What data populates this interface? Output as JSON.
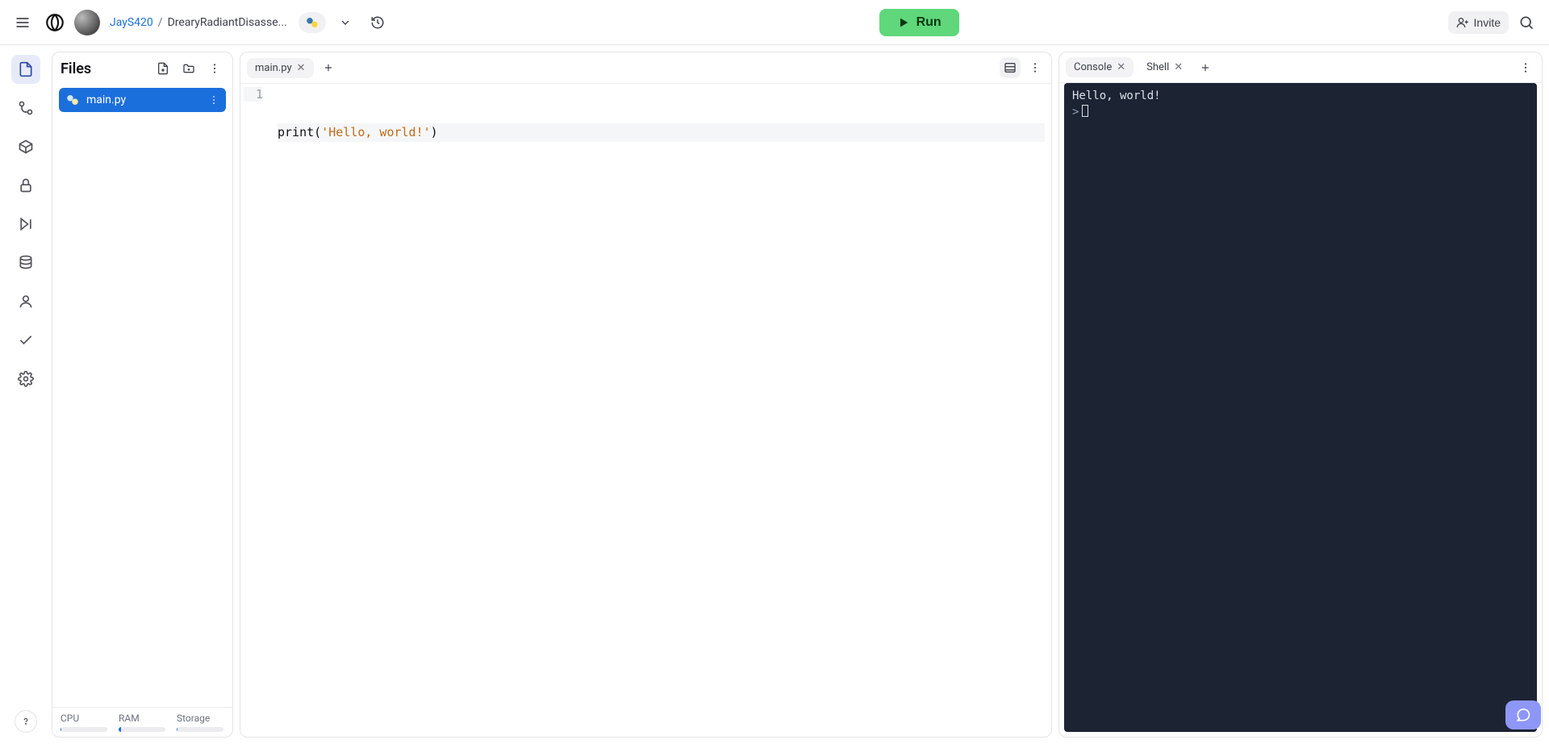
{
  "header": {
    "user": "JayS420",
    "sep": "/",
    "project": "DrearyRadiantDisasse...",
    "run_label": "Run",
    "invite_label": "Invite"
  },
  "rail": {
    "items": [
      {
        "name": "files-icon",
        "active": true
      },
      {
        "name": "version-control-icon",
        "active": false
      },
      {
        "name": "packages-icon",
        "active": false
      },
      {
        "name": "secrets-icon",
        "active": false
      },
      {
        "name": "debugger-icon",
        "active": false
      },
      {
        "name": "database-icon",
        "active": false
      },
      {
        "name": "account-icon",
        "active": false
      },
      {
        "name": "checkmark-icon",
        "active": false
      },
      {
        "name": "settings-icon",
        "active": false
      }
    ]
  },
  "files": {
    "title": "Files",
    "items": [
      {
        "name": "main.py",
        "active": true
      }
    ],
    "meters": [
      {
        "label": "CPU",
        "pct": 2
      },
      {
        "label": "RAM",
        "pct": 5
      },
      {
        "label": "Storage",
        "pct": 1
      }
    ]
  },
  "editor": {
    "tabs": [
      {
        "label": "main.py",
        "active": true
      }
    ],
    "line_no": "1",
    "code_fn": "print",
    "code_open": "(",
    "code_str": "'Hello, world!'",
    "code_close": ")"
  },
  "console": {
    "tabs": [
      {
        "label": "Console",
        "active": true
      },
      {
        "label": "Shell",
        "active": false
      }
    ],
    "output": "Hello, world!",
    "prompt": ">"
  }
}
